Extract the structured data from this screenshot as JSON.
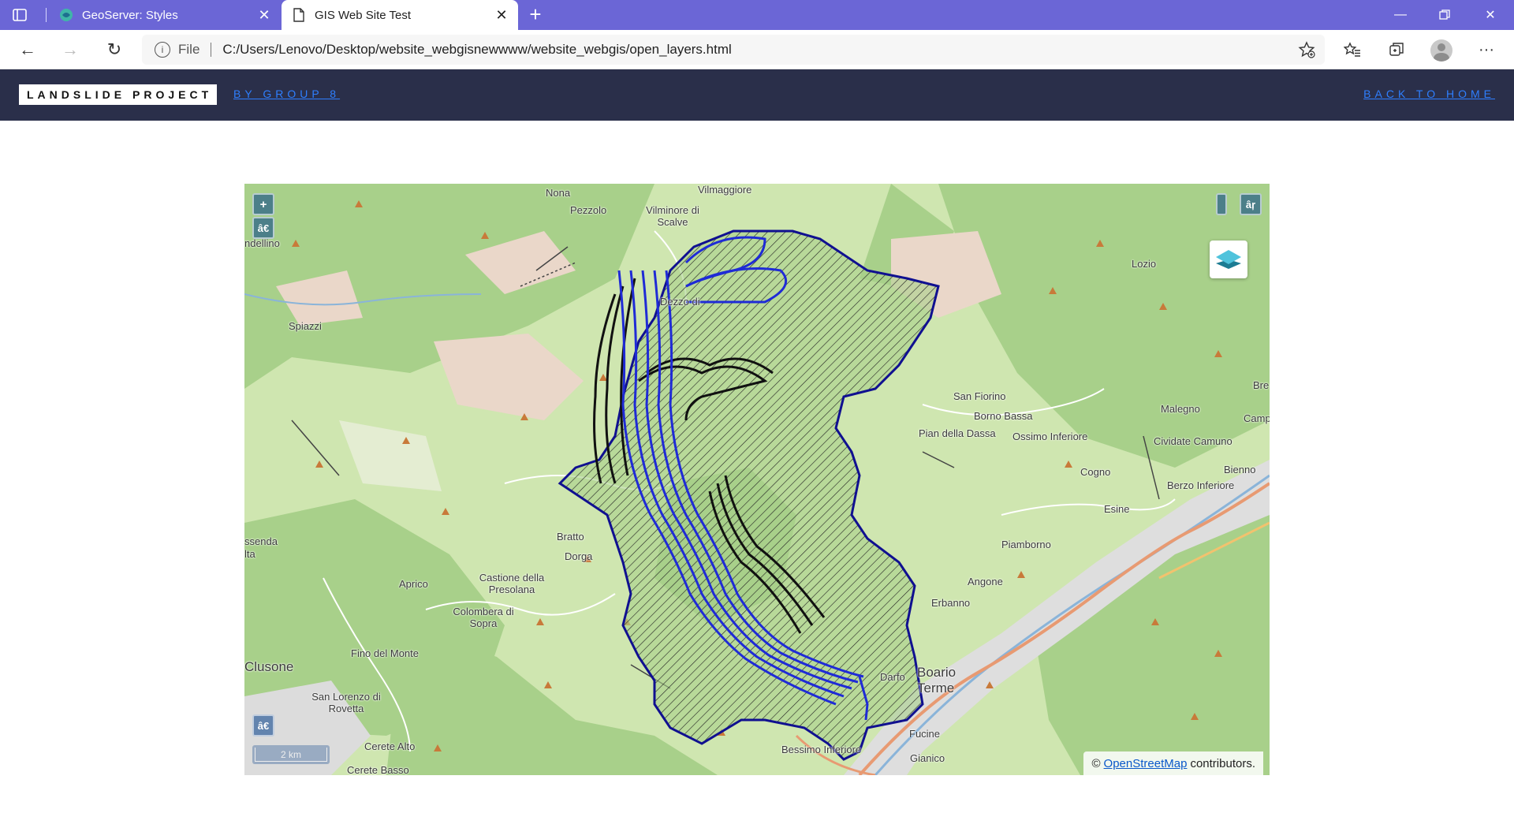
{
  "browser": {
    "tabs": [
      {
        "title": "GeoServer: Styles",
        "active": false,
        "favicon": "geoserver-icon"
      },
      {
        "title": "GIS Web Site Test",
        "active": true,
        "favicon": "page-icon"
      }
    ],
    "address": {
      "scheme": "File",
      "url": "C:/Users/Lenovo/Desktop/website_webgisnewwww/website_webgis/open_layers.html"
    },
    "colors": {
      "tabbar": "#6b66d6"
    }
  },
  "header": {
    "brand": "LANDSLIDE PROJECT",
    "by_group": "BY GROUP 8",
    "back_home": "BACK TO HOME",
    "colors": {
      "background": "#2a2f4a",
      "link": "#2e7fff"
    }
  },
  "map": {
    "controls": {
      "zoom_in": "+",
      "zoom_out_glyph": "â€",
      "fullscreen_glyph": "â€",
      "top_right_glyph": "âŗ"
    },
    "scale": "2 km",
    "attribution": {
      "prefix": "©",
      "link": "OpenStreetMap",
      "suffix": "contributors."
    },
    "place_labels": [
      "Nona",
      "Vilmaggiore",
      "Pezzolo",
      "Vilminore di Scalve",
      "Dezzo di",
      "Lozio",
      "Spiazzi",
      "San Fiorino",
      "Borno Bassa",
      "Pian della Dassa",
      "Ossimo Inferiore",
      "Malegno",
      "Cividate Camuno",
      "Bre",
      "Camp",
      "Cogno",
      "Bienno",
      "Berzo Inferiore",
      "Esine",
      "Piamborno",
      "Bratto",
      "Dorga",
      "Castione della Presolana",
      "Aprico",
      "Colombera di Sopra",
      "Fino del Monte",
      "Clusone",
      "San Lorenzo di Rovetta",
      "Cerete Alto",
      "Cerete Basso",
      "Angone",
      "Erbanno",
      "Boario Terme",
      "Darfo",
      "Fucine",
      "Bessimo Inferiore",
      "Gianico",
      "ndellino",
      "ssenda",
      "lta"
    ],
    "colors": {
      "basemap": "#cfe6b0",
      "forest": "#a8d08a",
      "catchment_outline": "#101090",
      "river_buffer": "#1f2bd6",
      "hazard_buffer": "#111111"
    }
  }
}
